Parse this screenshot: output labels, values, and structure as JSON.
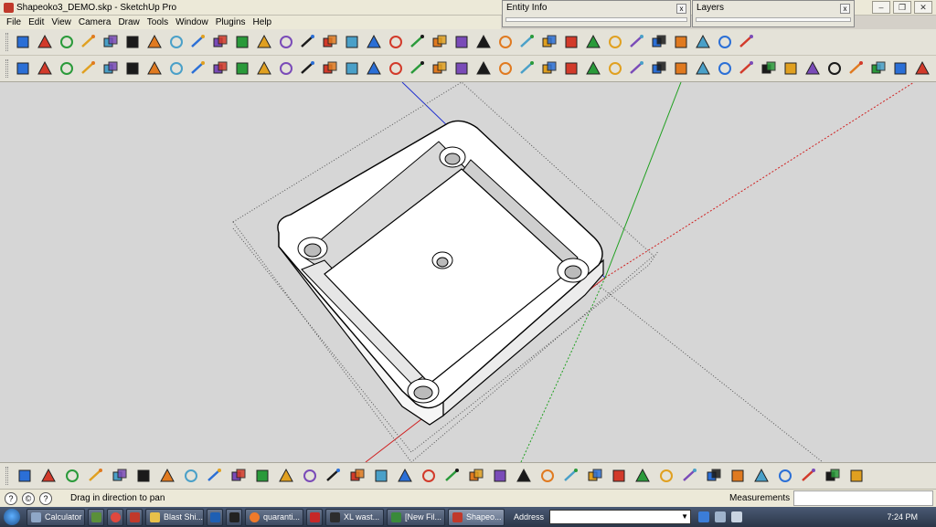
{
  "window": {
    "title": "Shapeoko3_DEMO.skp - SketchUp Pro",
    "buttons": [
      "–",
      "❐",
      "✕"
    ]
  },
  "menu": [
    "File",
    "Edit",
    "View",
    "Camera",
    "Draw",
    "Tools",
    "Window",
    "Plugins",
    "Help"
  ],
  "panels": {
    "entity_info": {
      "title": "Entity Info",
      "close": "x"
    },
    "layers": {
      "title": "Layers",
      "close": "x"
    }
  },
  "toolbar_top": {
    "icons": [
      "select-icon",
      "eraser-icon",
      "push-pull-icon",
      "move-icon",
      "paint-icon",
      "orbit-icon",
      "undo-icon",
      "redo-icon",
      "component-icon",
      "tape-measure-icon",
      "axes-icon",
      "protractor-icon",
      "text-icon",
      "dimension-icon",
      "section-plane-icon",
      "iso-view-icon",
      "top-view-icon",
      "front-view-icon",
      "follow-me-icon",
      "pencil-icon",
      "line-icon",
      "arc-icon",
      "circle-icon",
      "polygon-icon",
      "ellipse-icon",
      "offset-icon",
      "curve-icon",
      "freehand-icon",
      "spiral-icon",
      "bezier-icon",
      "shape-icon",
      "point-icon",
      "scale-icon",
      "measure-icon"
    ]
  },
  "toolbar_second": {
    "icons": [
      "flip-icon",
      "rotate-icon",
      "weld-icon",
      "path-icon",
      "fillet-icon",
      "chamfer-icon",
      "extrude-icon",
      "bend-icon",
      "twist-icon",
      "loft-icon",
      "sweep-icon",
      "shell-icon",
      "split-icon",
      "trim-icon",
      "extend-icon",
      "mirror-icon",
      "array-icon",
      "stack-icon",
      "drop-icon",
      "align-icon",
      "slice-icon",
      "project-icon",
      "surface-icon",
      "subdivide-icon",
      "smooth-icon",
      "knife-icon",
      "grid-icon",
      "hatch-icon",
      "stairs-icon",
      "roof-icon",
      "wall-icon",
      "window-tool-icon",
      "door-icon",
      "column-icon",
      "beam-icon",
      "rail-icon",
      "fence-icon",
      "terrain-icon",
      "sandbox-icon",
      "stamp-icon",
      "drape-icon",
      "contour-icon",
      "flat-icon",
      "cube-icon",
      "cylinder-icon",
      "cone-icon",
      "sphere-icon",
      "torus-icon"
    ]
  },
  "toolbar_bottom": {
    "icons": [
      "iso-view-icon",
      "box-icon",
      "house-icon",
      "front-elevation-icon",
      "back-elevation-icon",
      "side-elevation-icon",
      "orbit-icon",
      "pan-icon",
      "zoom-icon",
      "zoom-window-icon",
      "zoom-extents-icon",
      "previous-view-icon",
      "position-camera-icon",
      "look-around-icon",
      "walk-icon",
      "check-1-icon",
      "check-2-icon",
      "check-3-icon",
      "add-location-icon",
      "export-icon",
      "arrow-1-icon",
      "arrow-2-icon",
      "arrow-3-icon",
      "arrow-4-icon",
      "filter-1-icon",
      "filter-2-icon",
      "filter-3-icon",
      "flatten-icon",
      "raise-icon",
      "delete-icon",
      "smooth-1-icon",
      "smooth-2-icon",
      "help-icon",
      "red-cube-icon",
      "blue-cube-icon",
      "grey-cube-icon"
    ]
  },
  "status": {
    "message": "Drag in direction to pan",
    "measurements_label": "Measurements",
    "measurements_value": ""
  },
  "taskbar": {
    "tasks": [
      {
        "label": "Calculator",
        "color": "#8fa7c7"
      },
      {
        "label": "Blast Shi...",
        "color": "#e8c04a"
      },
      {
        "label": "quaranti...",
        "color": "#ef7a2a"
      },
      {
        "label": "XL wast...",
        "color": "#2d2d2d"
      },
      {
        "label": "[New Fil...",
        "color": "#3a8a3a"
      },
      {
        "label": "Shapeo...",
        "color": "#c0392b"
      }
    ],
    "address_label": "Address",
    "address_value": "",
    "clock": "7:24 PM"
  },
  "colors": {
    "accent_red": "#c0392b",
    "axis_red": "#d02020",
    "axis_green": "#20a020",
    "axis_blue": "#2030d0",
    "sky": "#d6d6d6"
  }
}
